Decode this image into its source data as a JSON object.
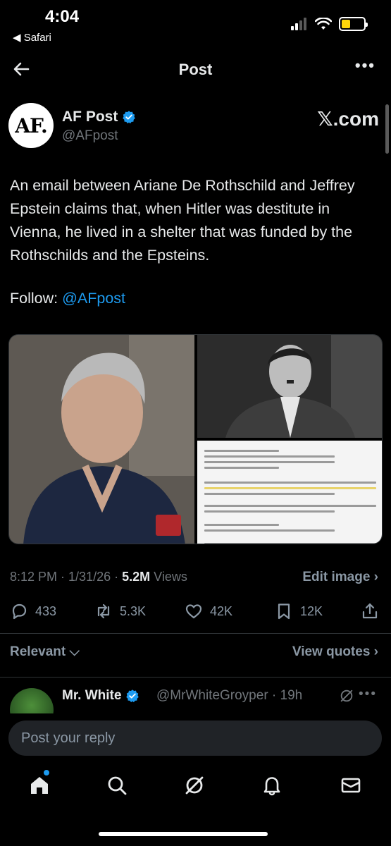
{
  "status_bar": {
    "time": "4:04",
    "back_app": "◀ Safari",
    "battery_level": 0.4
  },
  "header": {
    "title": "Post",
    "more": "•••"
  },
  "author": {
    "avatar_text": "AF.",
    "name": "AF Post",
    "handle": "@AFpost",
    "source": "𝕏.com"
  },
  "tweet": {
    "text": "An email between Ariane De Rothschild and Jeffrey Epstein claims that, when Hitler was destitute in Vienna, he lived in a shelter that was funded by the Rothschilds and the Epsteins.",
    "follow_label": "Follow: ",
    "follow_handle": "@AFpost"
  },
  "meta": {
    "time": "8:12 PM",
    "sep1": " · ",
    "date": "1/31/26",
    "sep2": " · ",
    "views_count": "5.2M",
    "views_label": " Views",
    "edit_image": "Edit image ›"
  },
  "actions": {
    "replies": "433",
    "reposts": "5.3K",
    "likes": "42K",
    "bookmarks": "12K"
  },
  "sort": {
    "relevant": "Relevant ⌵",
    "view_quotes": "View quotes ›"
  },
  "reply_preview": {
    "name": "Mr. White",
    "handle": "@MrWhiteGroyper · 19h",
    "more": "•••"
  },
  "reply_input": {
    "placeholder": "Post your reply"
  },
  "colors": {
    "background": "#000000",
    "accent": "#1d9bf0",
    "text": "#e7e9ea",
    "muted": "#71767b",
    "battery": "#ffd60a"
  }
}
